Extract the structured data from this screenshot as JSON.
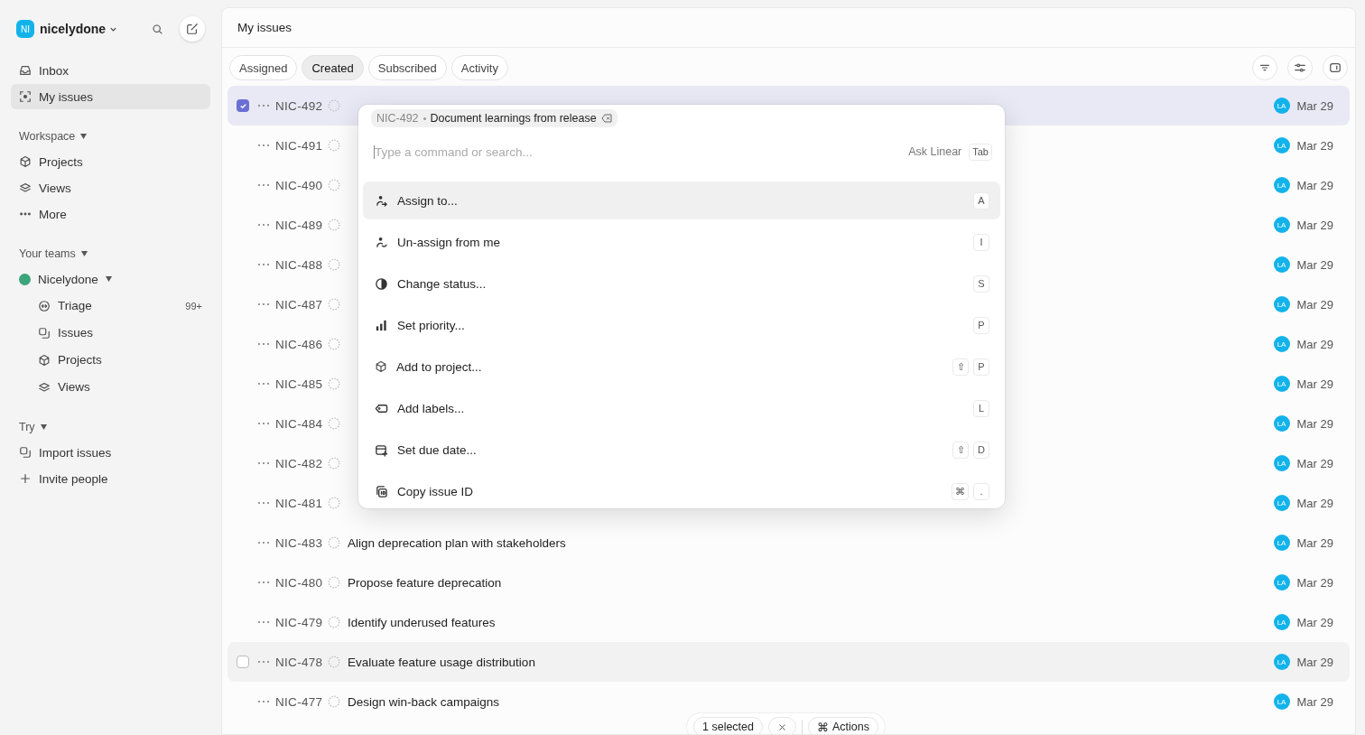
{
  "workspace": {
    "initials": "NI",
    "name": "nicelydone"
  },
  "sidebar": {
    "top_items": [
      {
        "label": "Inbox",
        "selected": false
      },
      {
        "label": "My issues",
        "selected": true
      }
    ],
    "sections": [
      {
        "title": "Workspace",
        "items": [
          {
            "label": "Projects",
            "selected": false
          },
          {
            "label": "Views",
            "selected": false
          },
          {
            "label": "More",
            "selected": false
          }
        ]
      },
      {
        "title": "Your teams",
        "team": {
          "name": "Nicelydone",
          "children": [
            {
              "label": "Triage",
              "badge": "99+",
              "selected": false
            },
            {
              "label": "Issues",
              "selected": false
            },
            {
              "label": "Projects",
              "selected": false
            },
            {
              "label": "Views",
              "selected": false
            }
          ]
        }
      },
      {
        "title": "Try",
        "items": [
          {
            "label": "Import issues",
            "selected": false
          },
          {
            "label": "Invite people",
            "selected": false
          }
        ]
      }
    ]
  },
  "page_title": "My issues",
  "tabs": [
    {
      "label": "Assigned",
      "selected": false
    },
    {
      "label": "Created",
      "selected": true
    },
    {
      "label": "Subscribed",
      "selected": false
    },
    {
      "label": "Activity",
      "selected": false
    }
  ],
  "rows": [
    {
      "id": "NIC-492",
      "selected": true,
      "hovered": false,
      "assignee": "LA",
      "date": "Mar 29"
    },
    {
      "id": "NIC-491",
      "selected": false,
      "hovered": false,
      "assignee": "LA",
      "date": "Mar 29"
    },
    {
      "id": "NIC-490",
      "selected": false,
      "hovered": false,
      "assignee": "LA",
      "date": "Mar 29"
    },
    {
      "id": "NIC-489",
      "selected": false,
      "hovered": false,
      "assignee": "LA",
      "date": "Mar 29"
    },
    {
      "id": "NIC-488",
      "selected": false,
      "hovered": false,
      "assignee": "LA",
      "date": "Mar 29"
    },
    {
      "id": "NIC-487",
      "selected": false,
      "hovered": false,
      "assignee": "LA",
      "date": "Mar 29"
    },
    {
      "id": "NIC-486",
      "selected": false,
      "hovered": false,
      "assignee": "LA",
      "date": "Mar 29"
    },
    {
      "id": "NIC-485",
      "selected": false,
      "hovered": false,
      "assignee": "LA",
      "date": "Mar 29"
    },
    {
      "id": "NIC-484",
      "selected": false,
      "hovered": false,
      "assignee": "LA",
      "date": "Mar 29"
    },
    {
      "id": "NIC-482",
      "selected": false,
      "hovered": false,
      "assignee": "LA",
      "date": "Mar 29"
    },
    {
      "id": "NIC-481",
      "selected": false,
      "hovered": false,
      "assignee": "LA",
      "date": "Mar 29"
    },
    {
      "id": "NIC-483",
      "title": "Align deprecation plan with stakeholders",
      "selected": false,
      "hovered": false,
      "assignee": "LA",
      "date": "Mar 29"
    },
    {
      "id": "NIC-480",
      "title": "Propose feature deprecation",
      "selected": false,
      "hovered": false,
      "assignee": "LA",
      "date": "Mar 29"
    },
    {
      "id": "NIC-479",
      "title": "Identify underused features",
      "selected": false,
      "hovered": false,
      "assignee": "LA",
      "date": "Mar 29"
    },
    {
      "id": "NIC-478",
      "title": "Evaluate feature usage distribution",
      "selected": false,
      "hovered": true,
      "assignee": "LA",
      "date": "Mar 29"
    },
    {
      "id": "NIC-477",
      "title": "Design win-back campaigns",
      "selected": false,
      "hovered": false,
      "assignee": "LA",
      "date": "Mar 29"
    }
  ],
  "command_menu": {
    "context": {
      "id": "NIC-492",
      "title": "Document learnings from release"
    },
    "placeholder": "Type a command or search...",
    "ask": {
      "label": "Ask Linear",
      "key": "Tab"
    },
    "items": [
      {
        "label": "Assign to...",
        "keys": [
          "A"
        ],
        "selected": true
      },
      {
        "label": "Un-assign from me",
        "keys": [
          "I"
        ],
        "selected": false
      },
      {
        "label": "Change status...",
        "keys": [
          "S"
        ],
        "selected": false
      },
      {
        "label": "Set priority...",
        "keys": [
          "P"
        ],
        "selected": false
      },
      {
        "label": "Add to project...",
        "keys": [
          "⇧",
          "P"
        ],
        "selected": false
      },
      {
        "label": "Add labels...",
        "keys": [
          "L"
        ],
        "selected": false
      },
      {
        "label": "Set due date...",
        "keys": [
          "⇧",
          "D"
        ],
        "selected": false
      },
      {
        "label": "Copy issue ID",
        "keys": [
          "⌘",
          "."
        ],
        "selected": false
      }
    ]
  },
  "selection_bar": {
    "count": "1 selected",
    "actions": {
      "key": "⌘",
      "label": "Actions"
    }
  }
}
